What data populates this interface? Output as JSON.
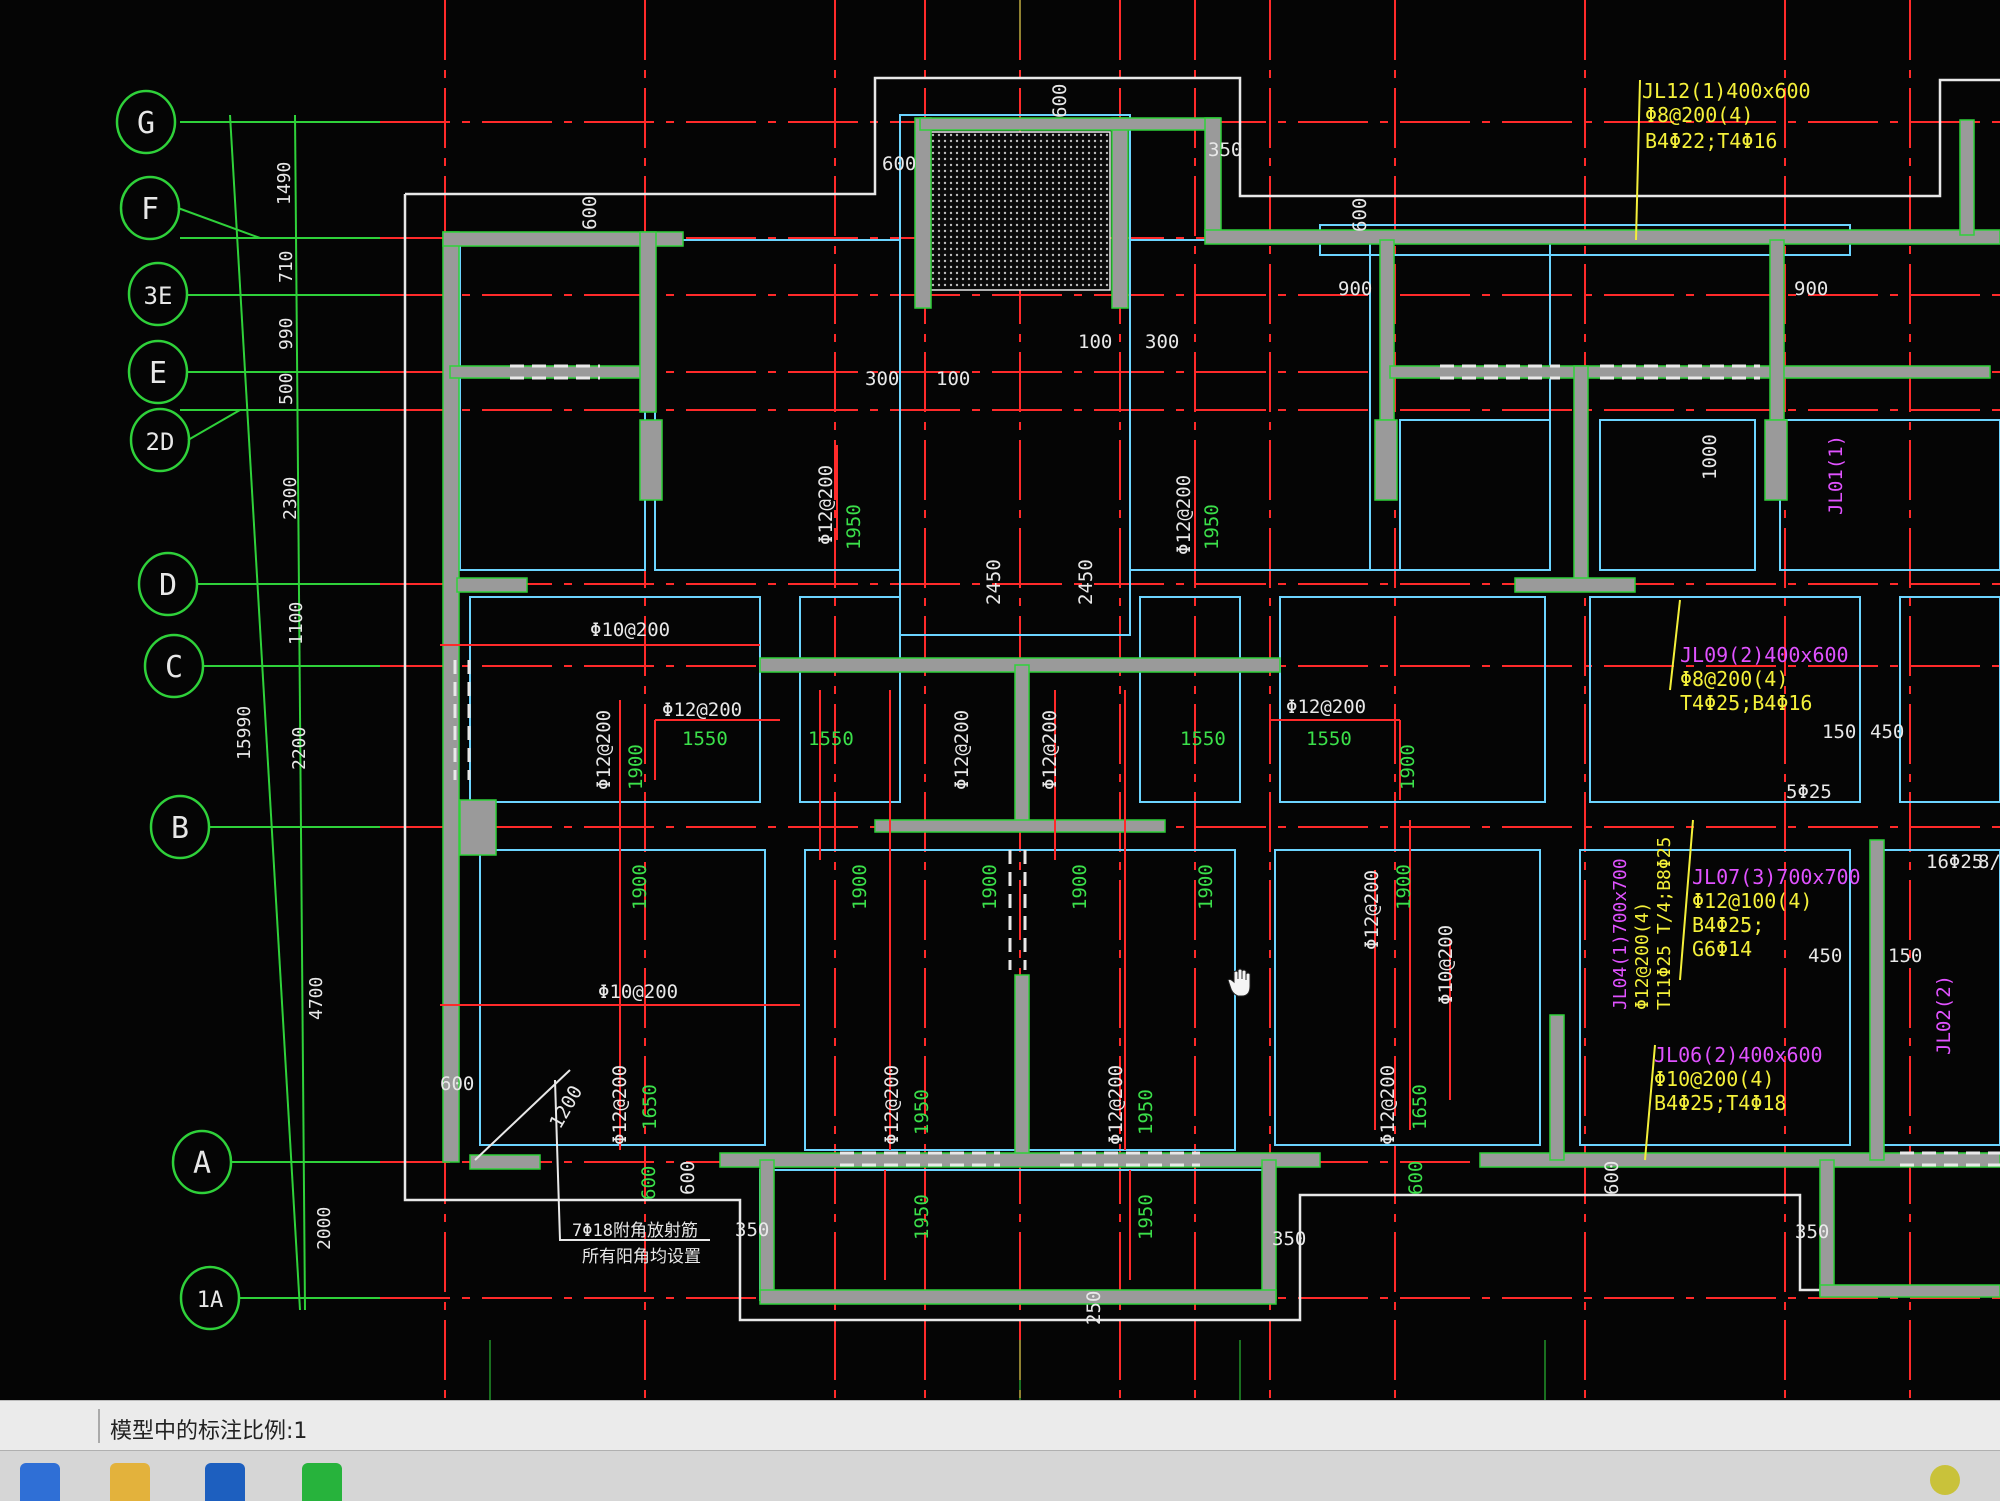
{
  "status_bar": {
    "annotation_scale_label": "模型中的标注比例:1"
  },
  "grid_axes": [
    "G",
    "F",
    "3E",
    "E",
    "2D",
    "D",
    "C",
    "B",
    "A",
    "1A"
  ],
  "grid_dims": {
    "total": "15990",
    "segments": [
      "1490",
      "710",
      "990",
      "500",
      "2300",
      "1100",
      "2200",
      "4700",
      "2000"
    ]
  },
  "beam_notes": {
    "jl12": {
      "line1": "JL12(1)400x600",
      "line2": "Φ8@200(4)",
      "line3": "B4Φ22;T4Φ16"
    },
    "jl09": {
      "line1": "JL09(2)400x600",
      "line2": "Φ8@200(4)",
      "line3": "T4Φ25;B4Φ16"
    },
    "jl07": {
      "line1": "JL07(3)700x700",
      "line2": "Φ12@100(4)",
      "line3": "B4Φ25;",
      "line4": "G6Φ14"
    },
    "jl04": {
      "line1": "JL04(1)700x700",
      "line2": "Φ12@200(4)",
      "line3": "T11Φ25 T/4;B8Φ25"
    },
    "jl06": {
      "line1": "JL06(2)400x600",
      "line2": "Φ10@200(4)",
      "line3": "B4Φ25;T4Φ18"
    },
    "jl01": "JL01(1)",
    "jl02": "JL02(2)"
  },
  "rebar_labels": {
    "r12_200": "Φ12@200",
    "r10_200": "Φ10@200"
  },
  "dimension_labels": {
    "d600": "600",
    "d350": "350",
    "d300": "300",
    "d100": "100",
    "d900": "900",
    "d1000": "1000",
    "d1950": "1950",
    "d2450": "2450",
    "d1550": "1550",
    "d1900": "1900",
    "d1650": "1650",
    "d1200": "1200",
    "d150": "150",
    "d450": "450",
    "d250": "250",
    "d5_25": "5Φ25",
    "d16_25": "16Φ25",
    "d8": "8/"
  },
  "corner_note": {
    "line1": "7Φ18附角放射筋",
    "line2": "所有阳角均设置"
  },
  "colors": {
    "background": "#050505",
    "axis_green": "#2fd13a",
    "axis_red": "#ff2a2a",
    "wall_grey": "#9a9a9a",
    "slab_cyan": "#6cd4ff",
    "outline_white": "#e8e8e8",
    "note_yellow": "#f4f03a",
    "note_magenta": "#e052ff",
    "dim_green": "#3be04a"
  }
}
